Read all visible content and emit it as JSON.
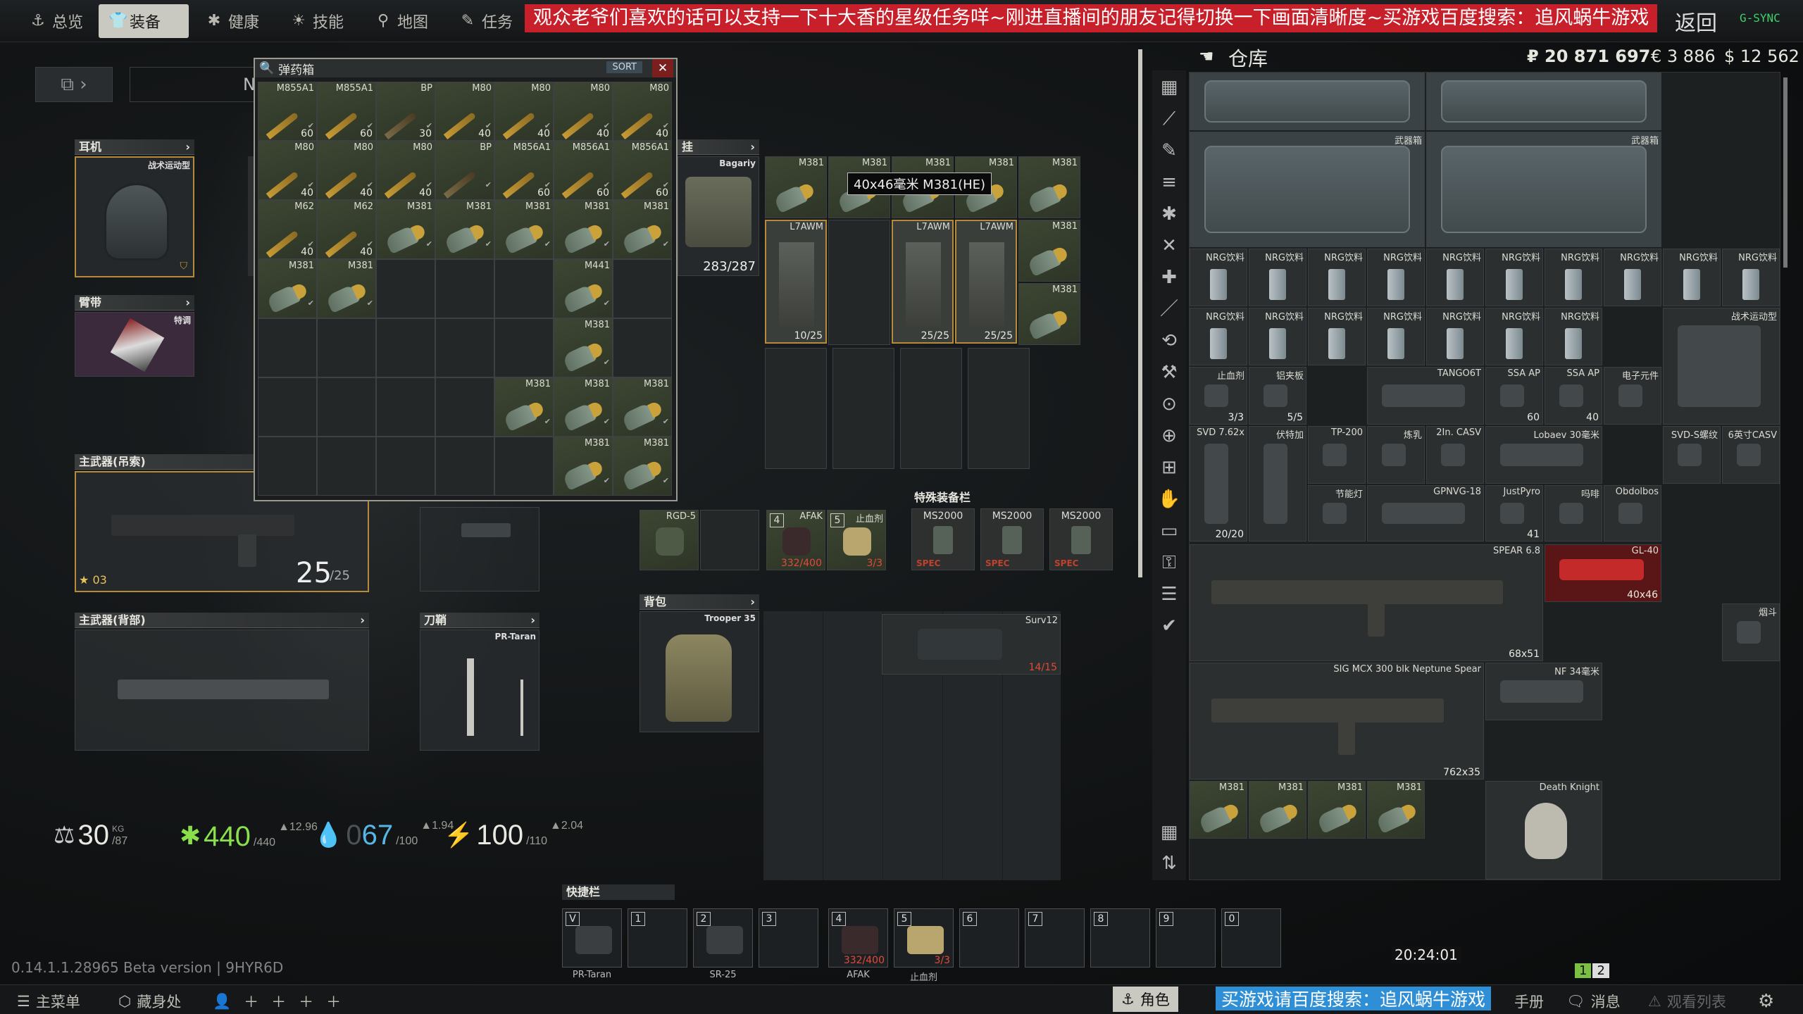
{
  "topnav": {
    "tabs": [
      {
        "label": "总览",
        "icon": "anchor-icon"
      },
      {
        "label": "装备",
        "icon": "shirt-icon",
        "active": true
      },
      {
        "label": "健康",
        "icon": "health-icon"
      },
      {
        "label": "技能",
        "icon": "sun-icon"
      },
      {
        "label": "地图",
        "icon": "pin-icon"
      },
      {
        "label": "任务",
        "icon": "edit-icon"
      }
    ],
    "banner": "观众老爷们喜欢的话可以支持一下十大香的星级任务咩~刚进直播间的朋友记得切换一下画面清晰度~买游戏百度搜索：追风蜗牛游戏",
    "back_label": "返回",
    "sync_label": "G-SYNC"
  },
  "equipment": {
    "headset_header": "耳机",
    "headset_item": "战术运动型",
    "armband_header": "臂带",
    "armband_item": "特调",
    "primary_sling_header": "主武器(吊索)",
    "primary_sling_count": "25",
    "primary_sling_max": "/25",
    "primary_sling_badge": "03",
    "primary_back_header": "主武器(背部)",
    "scabbard_header": "刀鞘",
    "scabbard_item": "PR-Taran",
    "rig_header": "挂",
    "rig_item": "Bagariy",
    "rig_durability": "283/287",
    "pockets": [
      {
        "label": "RGD-5"
      },
      {
        "label": ""
      },
      {
        "label": "AFAK",
        "key": "4",
        "count": "332/400"
      },
      {
        "label": "止血剂",
        "key": "5",
        "count": "3/3"
      }
    ],
    "special_header": "特殊装备栏",
    "special": [
      "MS2000",
      "MS2000",
      "MS2000"
    ],
    "special_tag": "SPEC",
    "backpack_header": "背包",
    "backpack_item": "Trooper 35",
    "backpack_content": {
      "label": "Surv12",
      "count": "14/15"
    }
  },
  "rig_contents": [
    {
      "label": "M381"
    },
    {
      "label": "M381"
    },
    {
      "label": "M381"
    },
    {
      "label": "M381"
    },
    {
      "label": "M381"
    },
    {
      "label": "L7AWM",
      "count": "10/25"
    },
    {
      "label": "L7AWM",
      "count": "25/25"
    },
    {
      "label": "L7AWM",
      "count": "25/25"
    },
    {
      "label": "M381"
    },
    {
      "label": "M381"
    }
  ],
  "tooltip": "40x46毫米 M381(HE)",
  "ammo_box": {
    "title": "弹药箱",
    "sort_label": "SORT",
    "close": "✕",
    "rows": [
      [
        {
          "l": "M855A1",
          "c": "60"
        },
        {
          "l": "M855A1",
          "c": "60"
        },
        {
          "l": "BP",
          "c": "30"
        },
        {
          "l": "M80",
          "c": "40"
        },
        {
          "l": "M80",
          "c": "40"
        },
        {
          "l": "M80",
          "c": "40"
        },
        {
          "l": "M80",
          "c": "40"
        }
      ],
      [
        {
          "l": "M80",
          "c": "40"
        },
        {
          "l": "M80",
          "c": "40"
        },
        {
          "l": "M80",
          "c": "40"
        },
        {
          "l": "BP",
          "c": ""
        },
        {
          "l": "M856A1",
          "c": "60"
        },
        {
          "l": "M856A1",
          "c": "60"
        },
        {
          "l": "M856A1",
          "c": "60"
        }
      ],
      [
        {
          "l": "M62",
          "c": "40"
        },
        {
          "l": "M62",
          "c": "40"
        },
        {
          "l": "M381",
          "c": "",
          "g": 1
        },
        {
          "l": "M381",
          "c": "",
          "g": 1
        },
        {
          "l": "M381",
          "c": "",
          "g": 1
        },
        {
          "l": "M381",
          "c": "",
          "g": 1
        },
        {
          "l": "M381",
          "c": "",
          "g": 1
        }
      ],
      [
        {
          "l": "M381",
          "c": "",
          "g": 1
        },
        {
          "l": "M381",
          "c": "",
          "g": 1
        },
        {
          "e": 1
        },
        {
          "e": 1
        },
        {
          "e": 1
        },
        {
          "l": "M441",
          "c": "",
          "g": 1
        },
        {
          "e": 1
        }
      ],
      [
        {
          "e": 1
        },
        {
          "e": 1
        },
        {
          "e": 1
        },
        {
          "e": 1
        },
        {
          "e": 1
        },
        {
          "l": "M381",
          "c": "",
          "g": 1
        },
        {
          "e": 1
        }
      ],
      [
        {
          "e": 1
        },
        {
          "e": 1
        },
        {
          "e": 1
        },
        {
          "e": 1
        },
        {
          "l": "M381",
          "c": "",
          "g": 1
        },
        {
          "l": "M381",
          "c": "",
          "g": 1
        },
        {
          "l": "M381",
          "c": "",
          "g": 1
        }
      ],
      [
        {
          "e": 1
        },
        {
          "e": 1
        },
        {
          "e": 1
        },
        {
          "e": 1
        },
        {
          "e": 1
        },
        {
          "l": "M381",
          "c": "",
          "g": 1
        },
        {
          "l": "M381",
          "c": "",
          "g": 1
        }
      ]
    ]
  },
  "stats": {
    "weight": "30",
    "weight_unit": "KG",
    "weight_max": "/87",
    "health": "440",
    "health_max": "/440",
    "health_delta": "▲12.96",
    "hydration": "67",
    "hydration_prefix": "0",
    "hydration_max": "/100",
    "hydration_delta": "▲1.94",
    "energy": "100",
    "energy_max": "/110",
    "energy_delta": "▲2.04"
  },
  "hotbar": {
    "header": "快捷栏",
    "slots": [
      {
        "key": "V",
        "label": "PR-Taran"
      },
      {
        "key": "1",
        "label": ""
      },
      {
        "key": "2",
        "label": "SR-25"
      },
      {
        "key": "3",
        "label": ""
      },
      {
        "key": "4",
        "label": "AFAK",
        "count": "332/400"
      },
      {
        "key": "5",
        "label": "止血剂",
        "count": "3/3"
      },
      {
        "key": "6",
        "label": ""
      },
      {
        "key": "7",
        "label": ""
      },
      {
        "key": "8",
        "label": ""
      },
      {
        "key": "9",
        "label": ""
      },
      {
        "key": "0",
        "label": ""
      }
    ]
  },
  "version": "0.14.1.1.28965 Beta version | 9HYR6D",
  "clock": "20:24:01",
  "page_indicator": [
    "1",
    "2"
  ],
  "bottombar": {
    "left": [
      "主菜单",
      "藏身处"
    ],
    "character": "角色",
    "ad": "买游戏请百度搜索：追风蜗牛游戏",
    "manual": "手册",
    "messages": "消息",
    "watchlist": "观看列表"
  },
  "stash": {
    "title": "仓库",
    "currency": {
      "rub": "₽ 20 871 697",
      "eur": "€ 3 886",
      "usd": "$ 12 562"
    },
    "case_label": "武器箱",
    "nrg_label": "NRG饮料",
    "items": [
      {
        "l": "止血剂",
        "c": "3/3"
      },
      {
        "l": "铝夹板",
        "c": "5/5"
      },
      {
        "l": "TANGO6T"
      },
      {
        "l": "SSA AP",
        "c": "60"
      },
      {
        "l": "SSA AP",
        "c": "40"
      },
      {
        "l": "电子元件"
      },
      {
        "l": "战术运动型"
      },
      {
        "l": "SVD 7.62x",
        "c": "20/20"
      },
      {
        "l": "伏特加"
      },
      {
        "l": "TP-200"
      },
      {
        "l": "炼乳"
      },
      {
        "l": "2In. CASV"
      },
      {
        "l": "Lobaev 30毫米"
      },
      {
        "l": "SVD-S螺纹"
      },
      {
        "l": "6英寸CASV"
      },
      {
        "l": "节能灯"
      },
      {
        "l": "GPNVG-18"
      },
      {
        "l": "JustPyro",
        "c": "41"
      },
      {
        "l": "吗啡"
      },
      {
        "l": "Obdolbos"
      },
      {
        "l": "SPEAR 6.8",
        "c": "68x51"
      },
      {
        "l": "GL-40",
        "c": "40x46"
      },
      {
        "l": "烟斗"
      },
      {
        "l": "SIG MCX 300 blk Neptune Spear",
        "c": "762x35"
      },
      {
        "l": "NF 34毫米"
      },
      {
        "l": "M381"
      },
      {
        "l": "M381"
      },
      {
        "l": "M381"
      },
      {
        "l": "M381"
      },
      {
        "l": "Death Knight"
      }
    ]
  }
}
